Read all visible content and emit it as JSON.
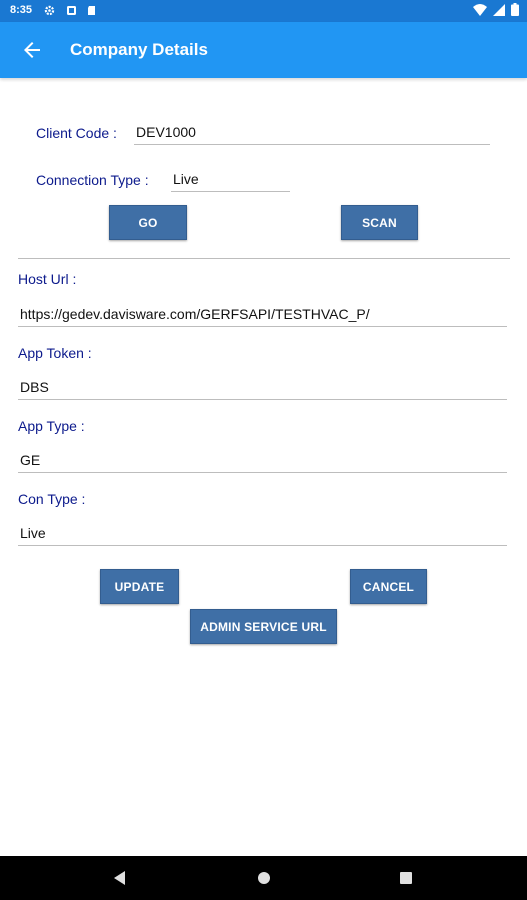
{
  "status_bar": {
    "time": "8:35",
    "icons": [
      "settings-icon",
      "notification-icon",
      "sd-card-icon",
      "wifi-icon",
      "signal-icon",
      "battery-icon"
    ]
  },
  "app_bar": {
    "title": "Company Details",
    "back_icon": "arrow-back-icon"
  },
  "connect_form": {
    "client_code_label": "Client Code :",
    "client_code_value": "DEV1000",
    "connection_type_label": "Connection Type :",
    "connection_type_value": "Live",
    "go_label": "GO",
    "scan_label": "SCAN"
  },
  "details": {
    "host_url_label": "Host Url :",
    "host_url_value": "https://gedev.davisware.com/GERFSAPI/TESTHVAC_P/",
    "app_token_label": "App Token :",
    "app_token_value": "DBS",
    "app_type_label": "App Type :",
    "app_type_value": "GE",
    "con_type_label": "Con Type :",
    "con_type_value": "Live"
  },
  "actions": {
    "update_label": "UPDATE",
    "cancel_label": "CANCEL",
    "admin_label": "ADMIN SERVICE URL"
  },
  "nav_bar": {
    "icons": [
      "back-triangle-icon",
      "home-circle-icon",
      "recents-square-icon"
    ]
  },
  "colors": {
    "status_bar": "#1a78d2",
    "app_bar": "#2196f3",
    "button": "#3f6fa6",
    "label": "#0c1a8c"
  }
}
